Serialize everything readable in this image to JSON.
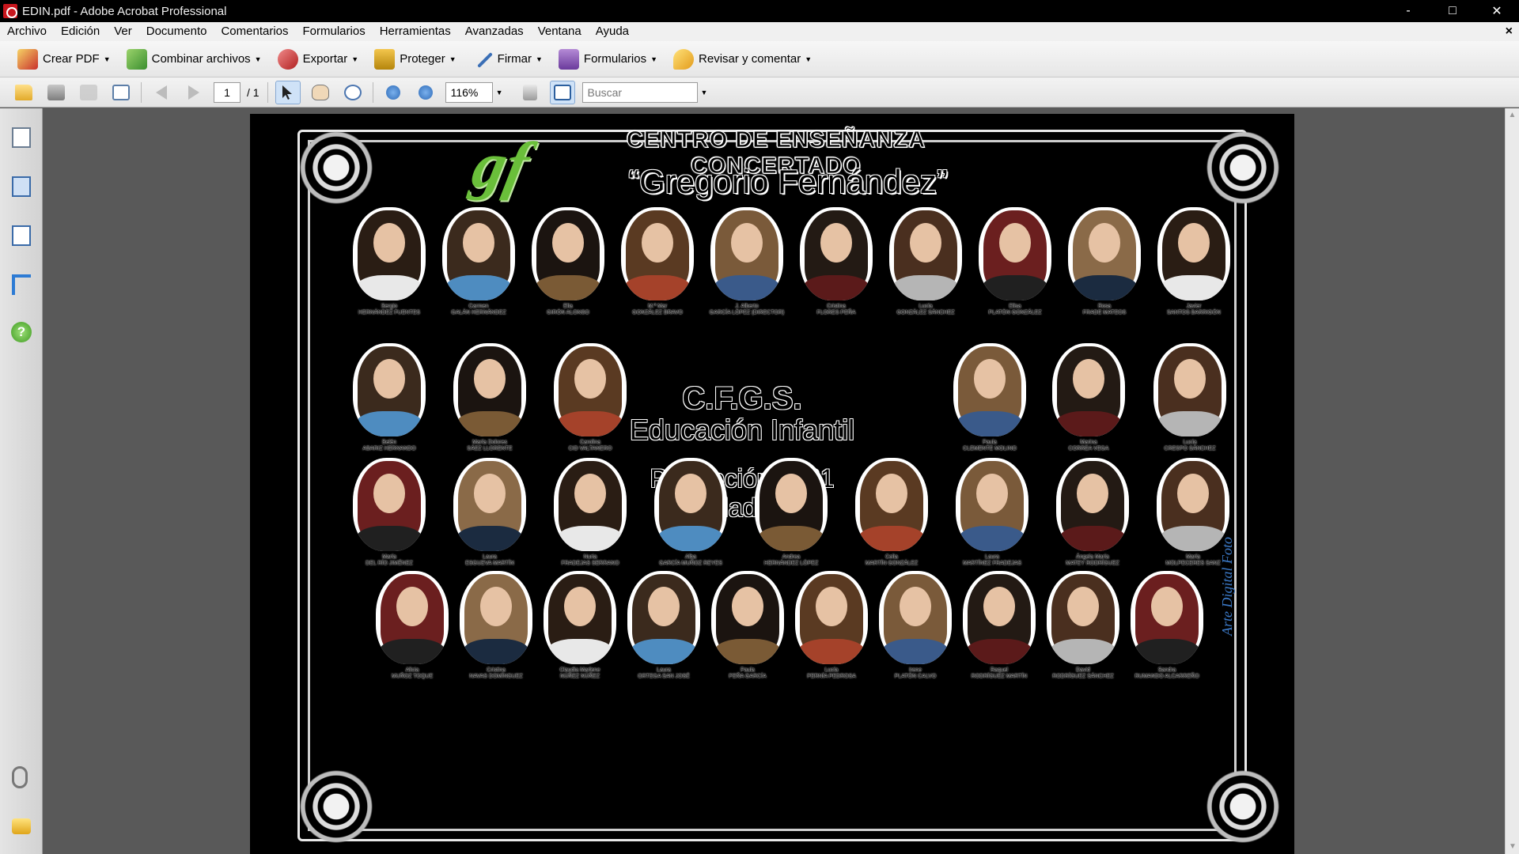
{
  "window": {
    "title": "EDIN.pdf - Adobe Acrobat Professional",
    "controls": [
      "-",
      "□",
      "✕"
    ]
  },
  "menu": [
    "Archivo",
    "Edición",
    "Ver",
    "Documento",
    "Comentarios",
    "Formularios",
    "Herramientas",
    "Avanzadas",
    "Ventana",
    "Ayuda"
  ],
  "menu_close": "×",
  "task_toolbar": [
    {
      "label": "Crear PDF",
      "icon": "create-pdf-icon"
    },
    {
      "label": "Combinar archivos",
      "icon": "combine-files-icon"
    },
    {
      "label": "Exportar",
      "icon": "export-icon"
    },
    {
      "label": "Proteger",
      "icon": "lock-icon"
    },
    {
      "label": "Firmar",
      "icon": "pen-icon"
    },
    {
      "label": "Formularios",
      "icon": "forms-icon"
    },
    {
      "label": "Revisar y comentar",
      "icon": "comment-icon"
    }
  ],
  "nav_toolbar": {
    "page_current": "1",
    "page_total": "/ 1",
    "zoom": "116%",
    "search_placeholder": "Buscar"
  },
  "document": {
    "center": "CENTRO DE ENSEÑANZA CONCERTADO",
    "school": "“Gregorio Fernández”",
    "logo": "gf",
    "course_code": "C.F.G.S.",
    "program": "Educación Infantil",
    "promotion": "Promoción 2021",
    "city": "Valladolid",
    "photographer": "Arte Digital Foto",
    "row1": [
      {
        "first": "Sergio",
        "last": "HERNÁNDEZ FUENTES"
      },
      {
        "first": "Carmen",
        "last": "GALÁN HERNÁNDEZ"
      },
      {
        "first": "Elia",
        "last": "GIRÓN ALONSO"
      },
      {
        "first": "M.ª Mar",
        "last": "GONZÁLEZ BRAVO"
      },
      {
        "first": "J. Alberto",
        "last": "GARCÍA LÓPEZ (Director)"
      },
      {
        "first": "Cristina",
        "last": "FLORES PEÑA"
      },
      {
        "first": "Lucía",
        "last": "GONZÁLEZ SÁNCHEZ"
      },
      {
        "first": "Elisa",
        "last": "PLATÓN GONZÁLEZ"
      },
      {
        "first": "Rosa",
        "last": "FRADE MATEOS"
      },
      {
        "first": "Javier",
        "last": "SANTOS BARRIGÓN"
      }
    ],
    "row2_left": [
      {
        "first": "Belén",
        "last": "ABARIZ HERNANDO"
      },
      {
        "first": "María Dolores",
        "last": "SÁEZ LLORENTE"
      },
      {
        "first": "Carolina",
        "last": "CID VALTANERO"
      }
    ],
    "row2_right": [
      {
        "first": "Paula",
        "last": "CLEMENTE MOLINO"
      },
      {
        "first": "Marina",
        "last": "CORREA VEGA"
      },
      {
        "first": "Lucía",
        "last": "CRESPO SÁNCHEZ"
      }
    ],
    "row3": [
      {
        "first": "María",
        "last": "DEL RÍO JIMÉNEZ"
      },
      {
        "first": "Laura",
        "last": "ESGUEVA MARTÍN"
      },
      {
        "first": "Nuria",
        "last": "FRADEJAS SERRANO"
      },
      {
        "first": "Alba",
        "last": "GARCÍA MUÑOZ REYES"
      },
      {
        "first": "Andrea",
        "last": "HERNÁNDEZ LÓPEZ"
      },
      {
        "first": "Celia",
        "last": "MARTÍN GONZÁLEZ"
      },
      {
        "first": "Laura",
        "last": "MARTÍNEZ FRADEJAS"
      },
      {
        "first": "Ángela María",
        "last": "MATEY RODRÍGUEZ"
      },
      {
        "first": "María",
        "last": "MOLPECERES SANZ"
      }
    ],
    "row4": [
      {
        "first": "Alicia",
        "last": "MUÑOZ TOQUE"
      },
      {
        "first": "Cristina",
        "last": "NAVAS DOMÍNGUEZ"
      },
      {
        "first": "Claudia Marlene",
        "last": "NÚÑEZ NÚÑEZ"
      },
      {
        "first": "Laura",
        "last": "ORTEGA SAN JOSÉ"
      },
      {
        "first": "Paula",
        "last": "PEÑA GARCÍA"
      },
      {
        "first": "Lucía",
        "last": "PERNÍA PEDROSA"
      },
      {
        "first": "Irene",
        "last": "PLATÓN CALVO"
      },
      {
        "first": "Raquel",
        "last": "RODRÍGUEZ MARTÍN"
      },
      {
        "first": "David",
        "last": "RODRÍGUEZ SÁNCHEZ"
      },
      {
        "first": "Sandra",
        "last": "RUMANDO ALCARREÑO"
      }
    ]
  }
}
